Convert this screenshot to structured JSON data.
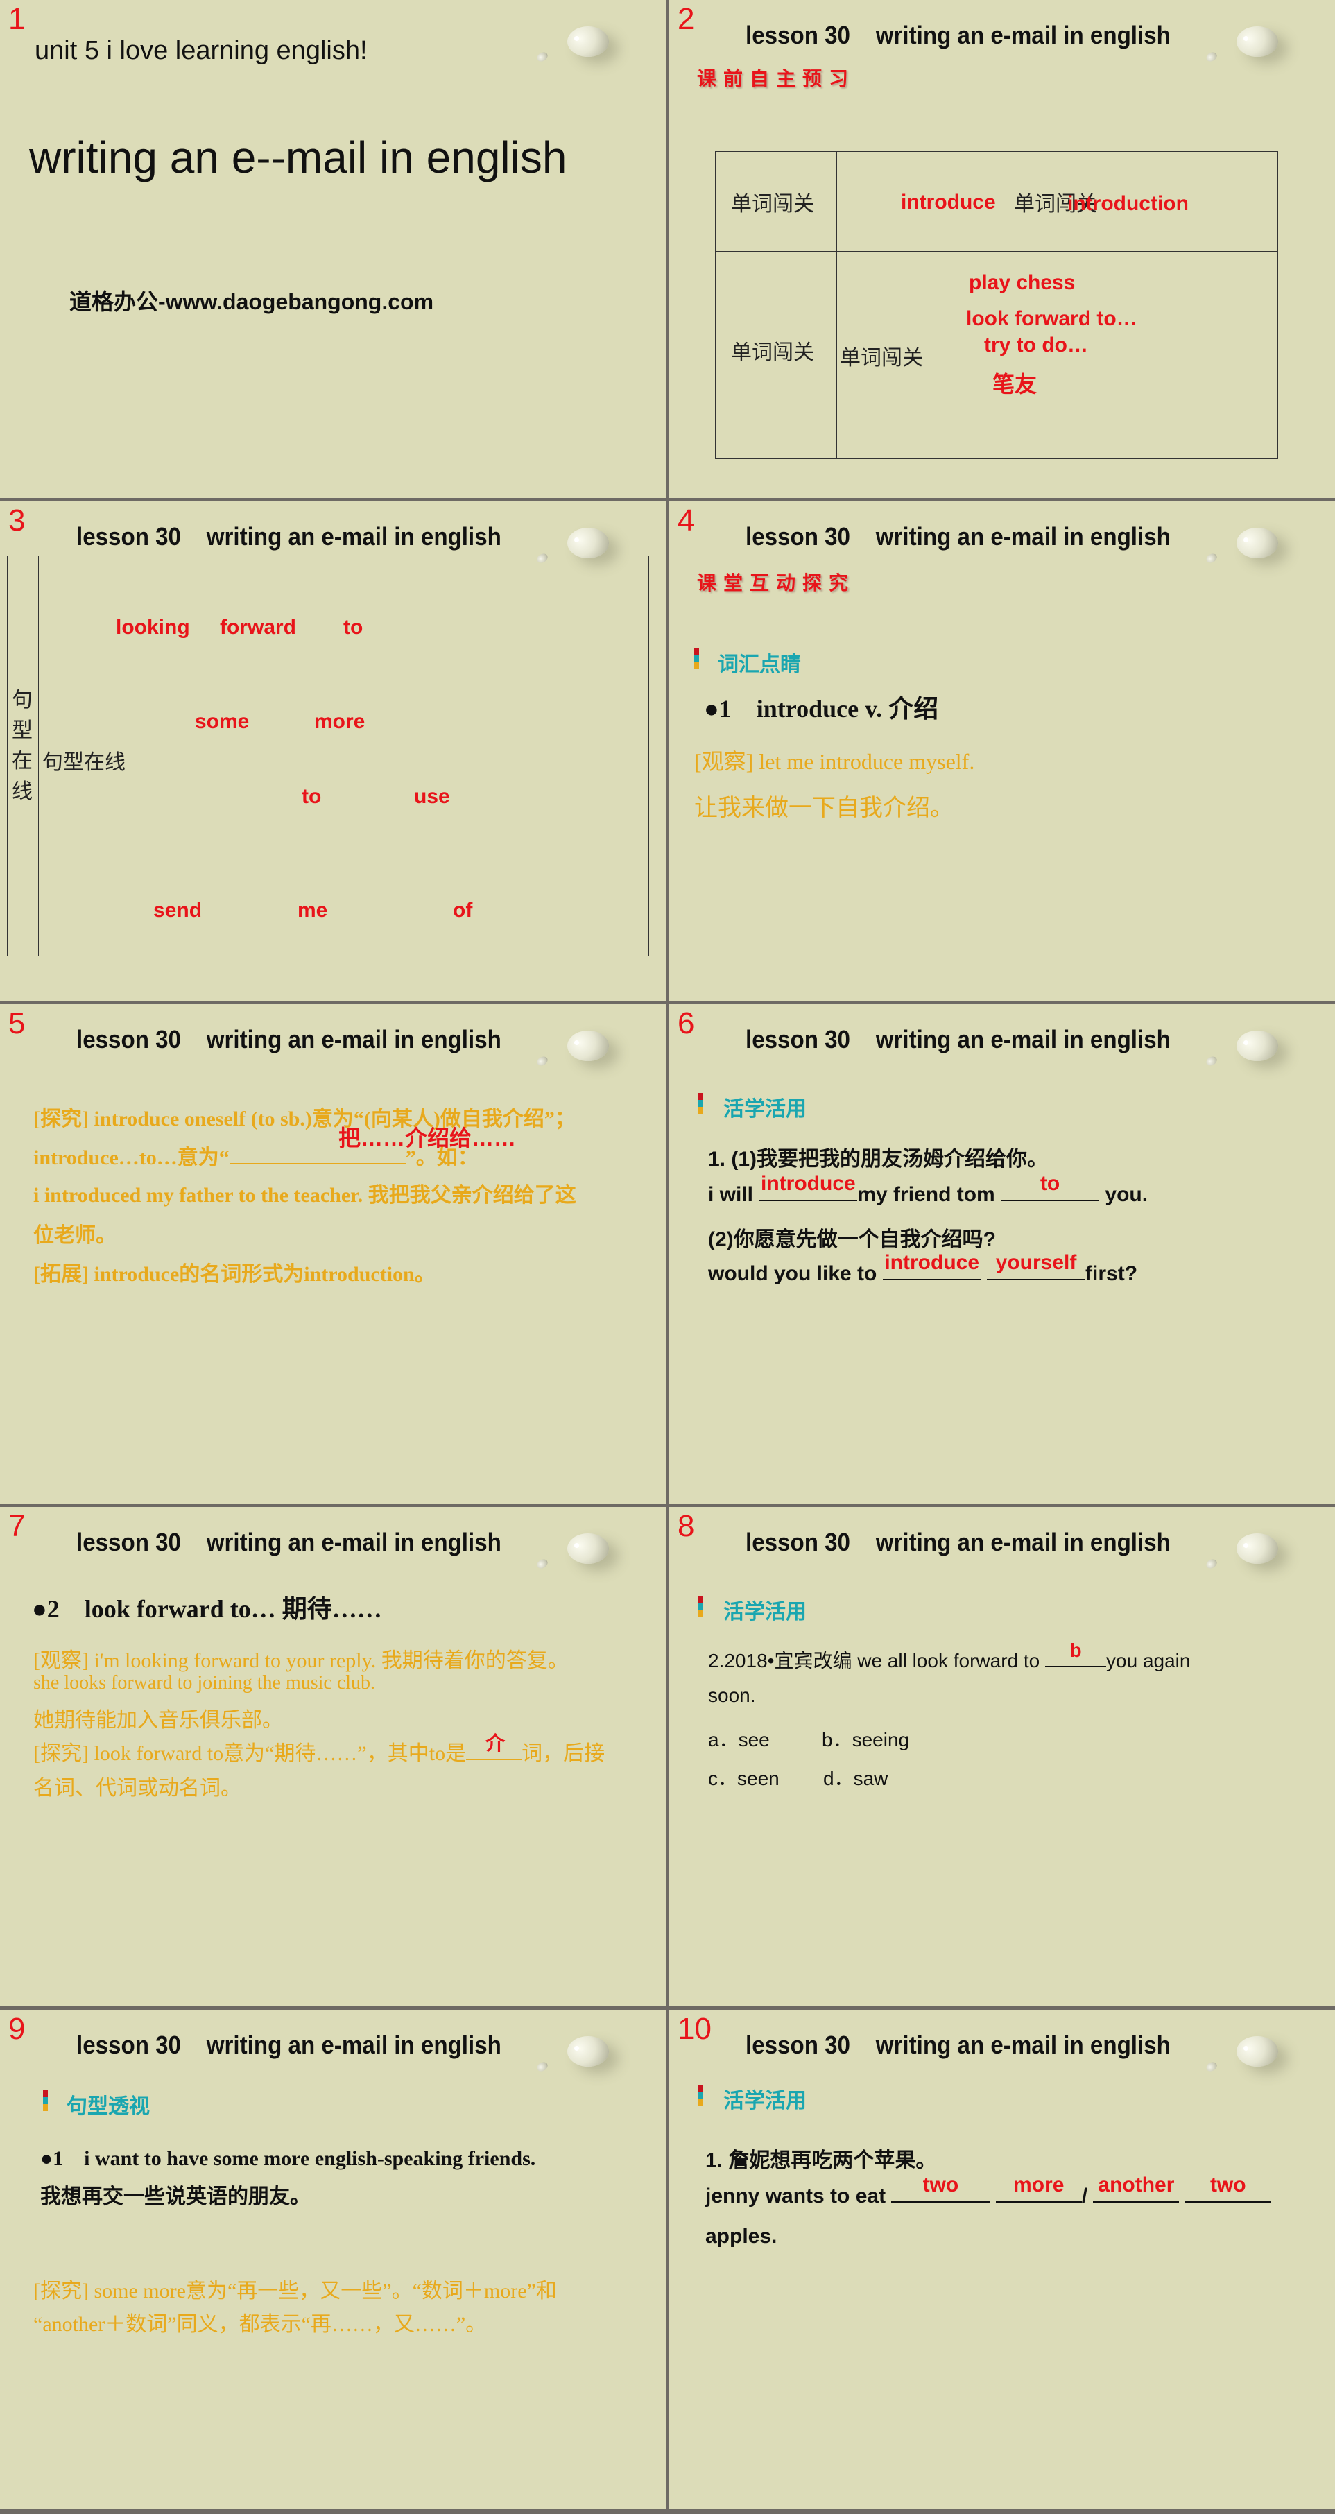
{
  "header_text": "lesson 30    writing an e-mail in english",
  "colors": {
    "accent_red": "#e8141a",
    "orange": "#e8a91c",
    "teal": "#1aa6b0",
    "slide_bg": "#dcdcb8",
    "divider": "#6e6a64"
  },
  "slides": [
    {
      "number": "1",
      "unit": "unit 5  i love learning english!",
      "title": "writing an e--mail in english",
      "footer": "道格办公-www.daogebangong.com"
    },
    {
      "number": "2",
      "section_title": "课前自主预习",
      "table": {
        "row1": {
          "label": "单词闯关",
          "placeholder": "单词闯关",
          "answers": [
            "introduce",
            "introduction"
          ]
        },
        "row2": {
          "label": "单词闯关",
          "placeholder": "单词闯关",
          "answers": [
            "play chess",
            "look forward to…",
            "try to do…",
            "笔友"
          ]
        }
      }
    },
    {
      "number": "3",
      "side_label": [
        "句",
        "型",
        "在",
        "线"
      ],
      "placeholder": "句型在线",
      "answers": [
        [
          "looking",
          "forward",
          "to"
        ],
        [
          "some",
          "more"
        ],
        [
          "to",
          "use"
        ],
        [
          "send",
          "me",
          "of"
        ]
      ]
    },
    {
      "number": "4",
      "section_title": "课堂互动探究",
      "subsection": "词汇点睛",
      "point": {
        "bullet": "●1",
        "word": "introduce v. 介绍"
      },
      "observe_en": "[观察] let me introduce myself.",
      "observe_zh": "让我来做一下自我介绍。"
    },
    {
      "number": "5",
      "lines": [
        "[探究] introduce oneself (to sb.)意为“(向某人)做自我介绍”；",
        "introduce…to…意为“",
        "”。如：",
        "i introduced my father to the teacher. 我把我父亲介绍给了这",
        "位老师。",
        "[拓展] introduce的名词形式为introduction。"
      ],
      "answer": "把……介绍给……"
    },
    {
      "number": "6",
      "subsection": "活学活用",
      "q1_zh": "1. (1)我要把我的朋友汤姆介绍给你。",
      "q1_en": [
        "i will ",
        "my friend tom ",
        " you."
      ],
      "q1_answers": [
        "introduce",
        "to"
      ],
      "q2_zh": "(2)你愿意先做一个自我介绍吗?",
      "q2_en": [
        "would you like to ",
        " ",
        "first?"
      ],
      "q2_answers": [
        "introduce",
        "yourself"
      ]
    },
    {
      "number": "7",
      "point": {
        "bullet": "●2",
        "word": "look forward to… 期待……"
      },
      "lines": [
        "[观察] i'm looking forward to your reply. 我期待着你的答复。",
        "she looks forward to joining the music club.",
        "她期待能加入音乐俱乐部。",
        "[探究] look forward to意为“期待……”，其中to是",
        "词，后接",
        "名词、代词或动名词。"
      ],
      "answer": "介"
    },
    {
      "number": "8",
      "subsection": "活学活用",
      "question": [
        "2.2018•宜宾改编  we all look forward to ",
        "you again",
        "soon."
      ],
      "answer": "b",
      "options": [
        "a．see",
        "b．seeing",
        "c．seen",
        "d．saw"
      ]
    },
    {
      "number": "9",
      "subsection": "句型透视",
      "point": {
        "bullet": "●1",
        "sentence": "i want to have some more english-speaking friends."
      },
      "translation": "我想再交一些说英语的朋友。",
      "explore": [
        "[探究] some more意为“再一些，又一些”。“数词＋more”和",
        "“another＋数词”同义，都表示“再……，又……”。"
      ]
    },
    {
      "number": "10",
      "subsection": "活学活用",
      "q_zh": "1. 詹妮想再吃两个苹果。",
      "q_en": [
        "jenny wants to eat ",
        "/",
        "apples."
      ],
      "answers": [
        "two",
        "more",
        "another",
        "two"
      ]
    }
  ]
}
